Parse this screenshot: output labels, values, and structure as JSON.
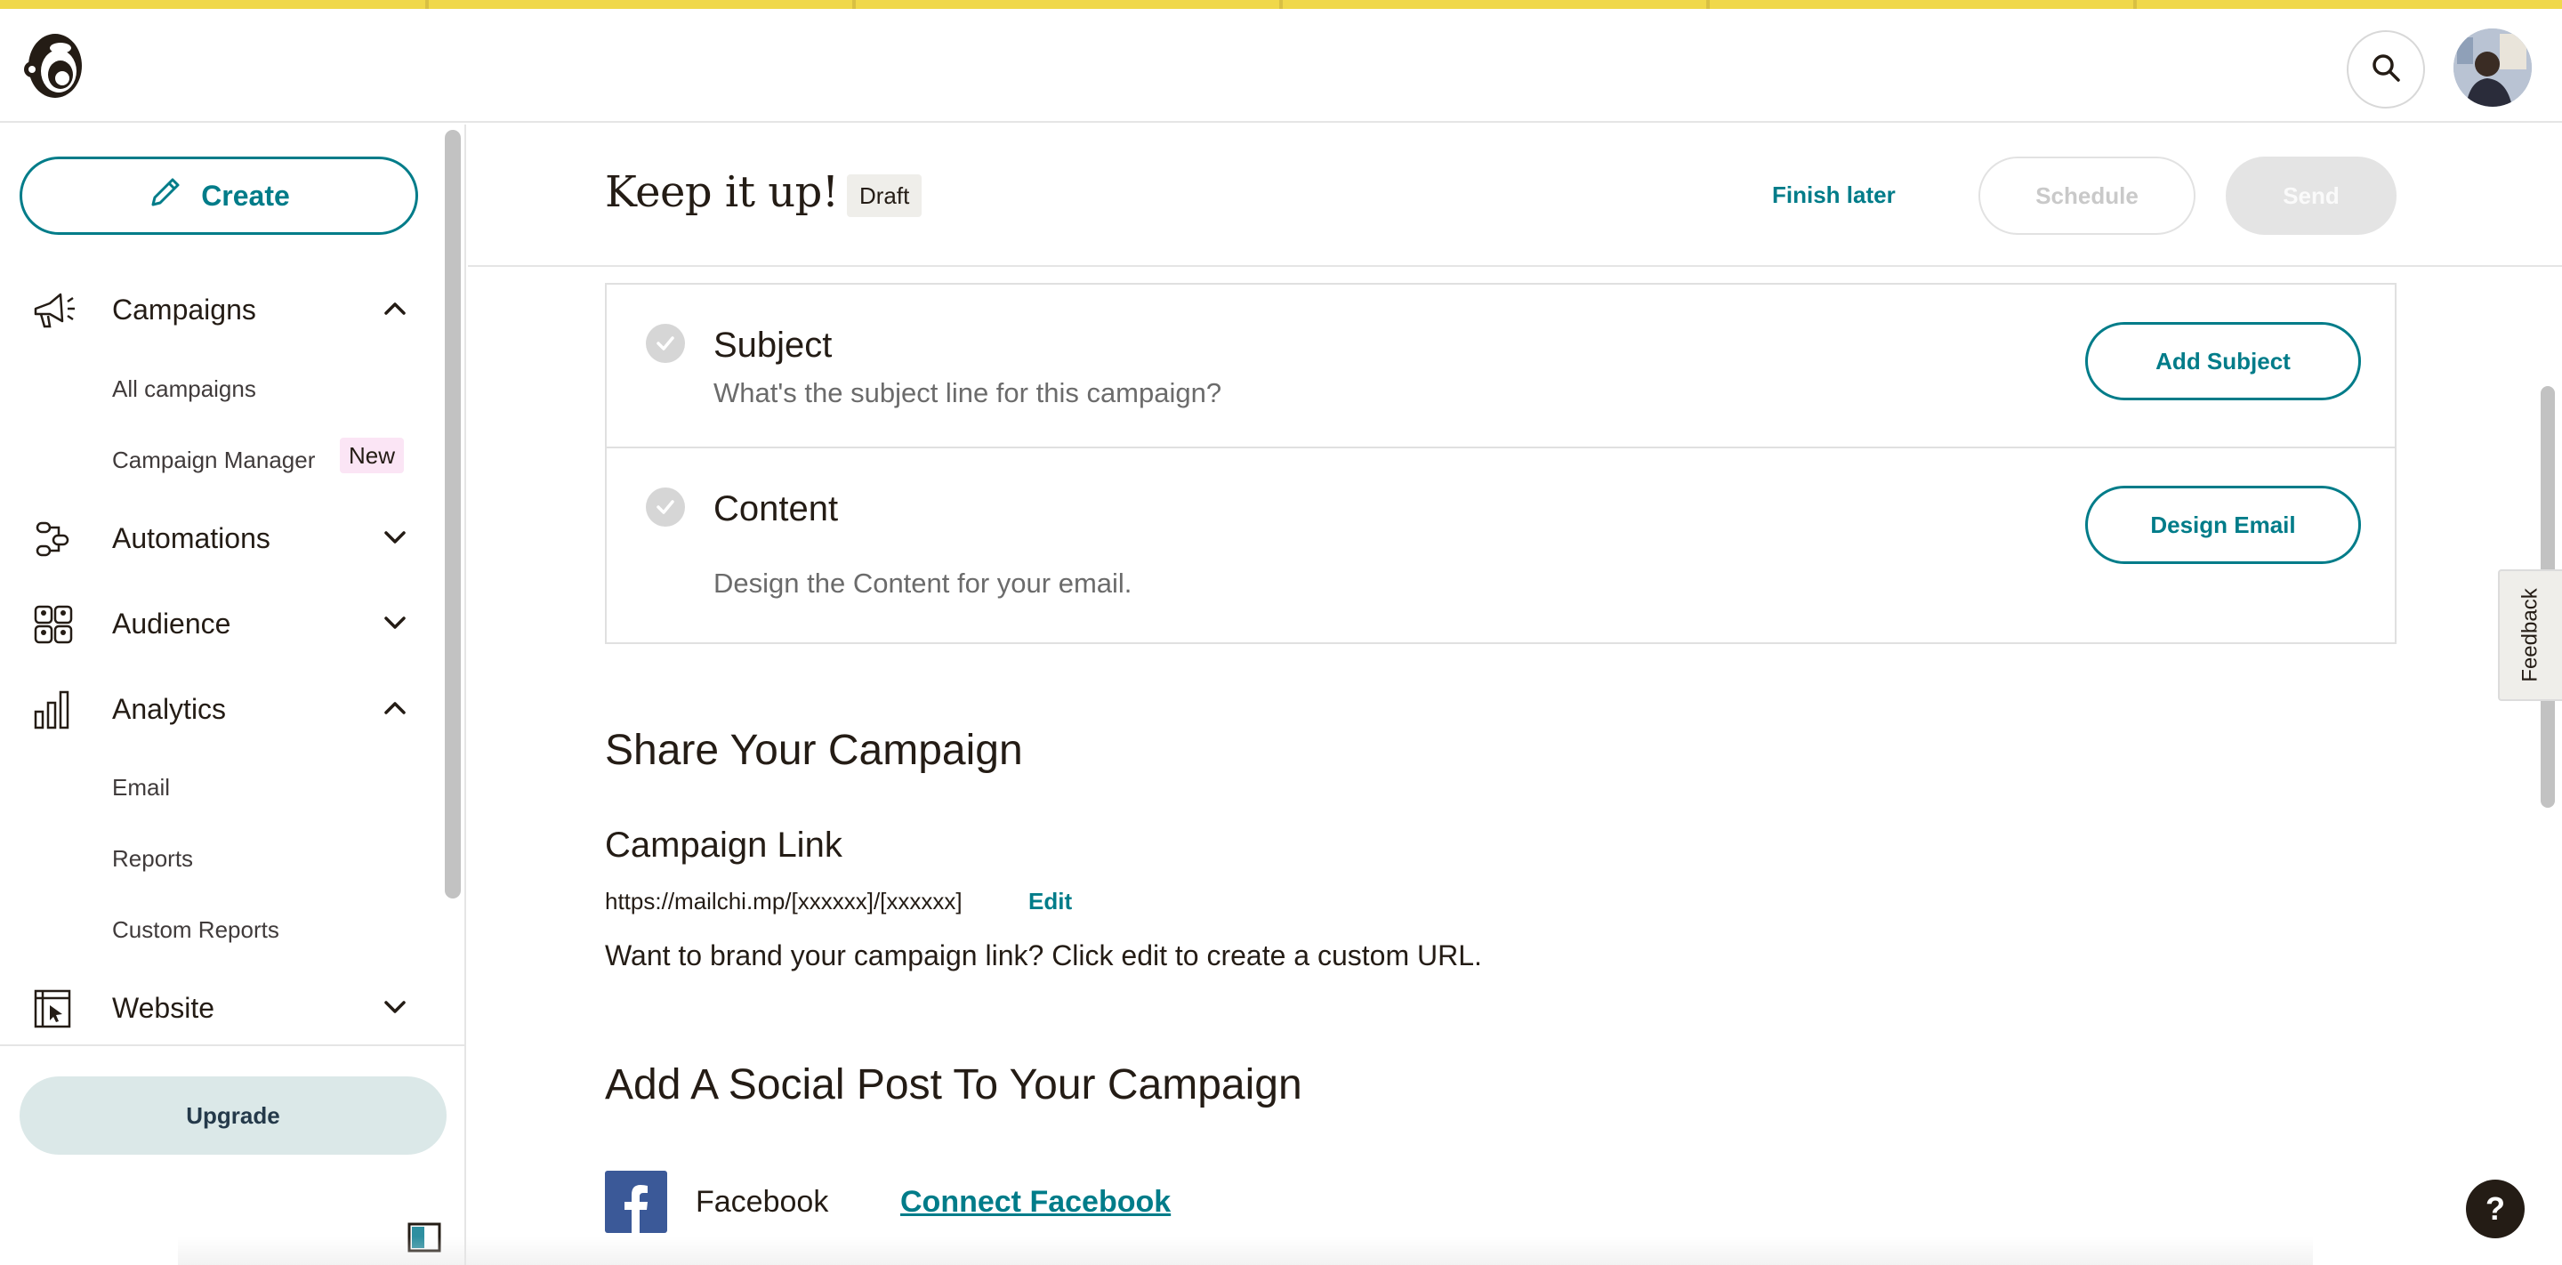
{
  "header": {
    "logo_icon": "mailchimp-freddie-logo-icon",
    "search_icon": "search-icon",
    "avatar_icon": "user-avatar"
  },
  "sidebar": {
    "create_label": "Create",
    "groups": [
      {
        "label": "Campaigns",
        "icon": "megaphone-icon",
        "expanded": true
      },
      {
        "label": "Automations",
        "icon": "workflow-icon",
        "expanded": false
      },
      {
        "label": "Audience",
        "icon": "audience-icon",
        "expanded": false
      },
      {
        "label": "Analytics",
        "icon": "bar-chart-icon",
        "expanded": true
      },
      {
        "label": "Website",
        "icon": "website-cursor-icon",
        "expanded": false
      }
    ],
    "campaign_items": [
      "All campaigns",
      "Campaign Manager"
    ],
    "campaign_manager_badge": "New",
    "analytics_items": [
      "Email",
      "Reports",
      "Custom Reports"
    ],
    "upgrade_label": "Upgrade"
  },
  "main_header": {
    "title": "Keep it up!",
    "status_badge": "Draft",
    "finish_later": "Finish later",
    "schedule": "Schedule",
    "send": "Send"
  },
  "checklist": [
    {
      "title": "Subject",
      "description": "What's the subject line for this campaign?",
      "action": "Add Subject"
    },
    {
      "title": "Content",
      "description": "Design the Content for your email.",
      "action": "Design Email"
    }
  ],
  "share": {
    "title": "Share Your Campaign",
    "link_title": "Campaign Link",
    "url": "https://mailchi.mp/[xxxxxx]/[xxxxxx]",
    "edit": "Edit",
    "help": "Want to brand your campaign link? Click edit to create a custom URL."
  },
  "social": {
    "title": "Add A Social Post To Your Campaign",
    "platform": "Facebook",
    "connect": "Connect Facebook"
  },
  "feedback": "Feedback",
  "help_label": "?",
  "colors": {
    "accent": "#007c89",
    "top_strip": "#f0d84a",
    "facebook": "#3b5998"
  }
}
